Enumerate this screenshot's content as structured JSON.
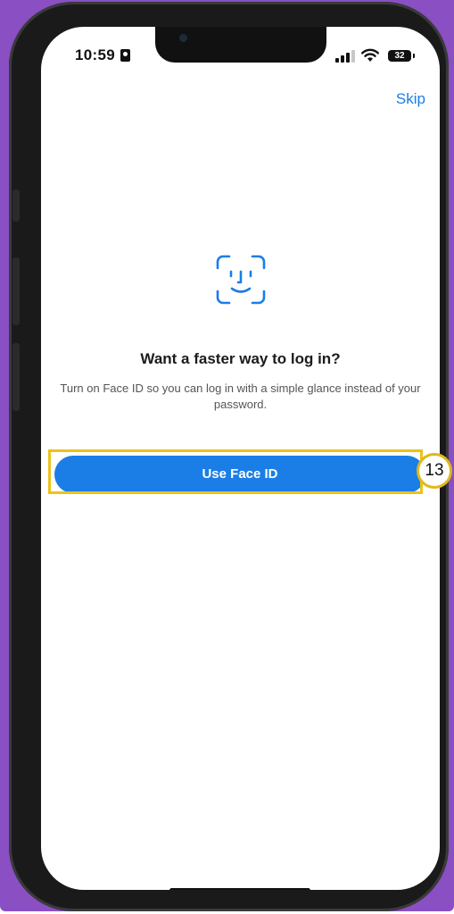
{
  "status_bar": {
    "time": "10:59",
    "battery": "32"
  },
  "header": {
    "skip_label": "Skip"
  },
  "prompt": {
    "headline": "Want a faster way to log in?",
    "subtext": "Turn on Face ID so you can log in with a simple glance instead of your password."
  },
  "actions": {
    "use_face_id_label": "Use Face ID"
  },
  "annotation": {
    "step_number": "13"
  },
  "colors": {
    "accent": "#1a7ee6",
    "highlight": "#ecc21b",
    "backdrop": "#8a4fc3"
  },
  "icons": {
    "face_id": "face-id-icon"
  }
}
